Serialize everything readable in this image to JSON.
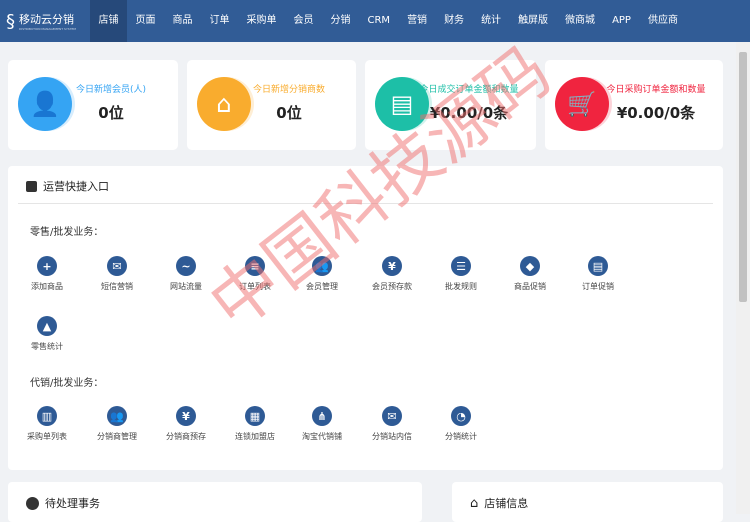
{
  "nav": {
    "logo": "移动云分销",
    "logo_sub": "DISTRIBUTION MANAGEMENT SYSTEM",
    "items": [
      "店铺",
      "页面",
      "商品",
      "订单",
      "采购单",
      "会员",
      "分销",
      "CRM",
      "营销",
      "财务",
      "统计",
      "触屏版",
      "微商城",
      "APP",
      "供应商"
    ],
    "active": 0
  },
  "stats": [
    {
      "title": "今日新增会员(人)",
      "value": "0位",
      "color": "#35a4f3",
      "icon": "user-add-icon"
    },
    {
      "title": "今日新增分销商数",
      "value": "0位",
      "color": "#f9ac2e",
      "icon": "store-icon"
    },
    {
      "title": "今日成交订单金额和数量",
      "value": "¥0.00/0条",
      "color": "#1dbfa7",
      "icon": "document-check-icon"
    },
    {
      "title": "今日采购订单金额和数量",
      "value": "¥0.00/0条",
      "color": "#f0243f",
      "icon": "cart-icon"
    }
  ],
  "quick": {
    "title": "运营快捷入口",
    "retail_label": "零售/批发业务：",
    "retail": [
      {
        "label": "添加商品",
        "g": "+"
      },
      {
        "label": "短信营销",
        "g": "✉"
      },
      {
        "label": "网站流量",
        "g": "~"
      },
      {
        "label": "订单列表",
        "g": "≡"
      },
      {
        "label": "会员管理",
        "g": "👥"
      },
      {
        "label": "会员预存款",
        "g": "¥"
      },
      {
        "label": "批发规则",
        "g": "☰"
      },
      {
        "label": "商品促销",
        "g": "◆"
      },
      {
        "label": "订单促销",
        "g": "▤"
      },
      {
        "label": "零售统计",
        "g": "▲"
      }
    ],
    "agent_label": "代销/批发业务：",
    "agent": [
      {
        "label": "采购单列表",
        "g": "▥"
      },
      {
        "label": "分销商管理",
        "g": "👥"
      },
      {
        "label": "分销商预存",
        "g": "¥"
      },
      {
        "label": "连锁加盟店",
        "g": "▦"
      },
      {
        "label": "淘宝代销铺",
        "g": "⋔"
      },
      {
        "label": "分销站内信",
        "g": "✉"
      },
      {
        "label": "分销统计",
        "g": "◔"
      }
    ]
  },
  "pending": {
    "title": "待处理事务"
  },
  "store": {
    "title": "店铺信息"
  },
  "watermark": "中国科技源码"
}
